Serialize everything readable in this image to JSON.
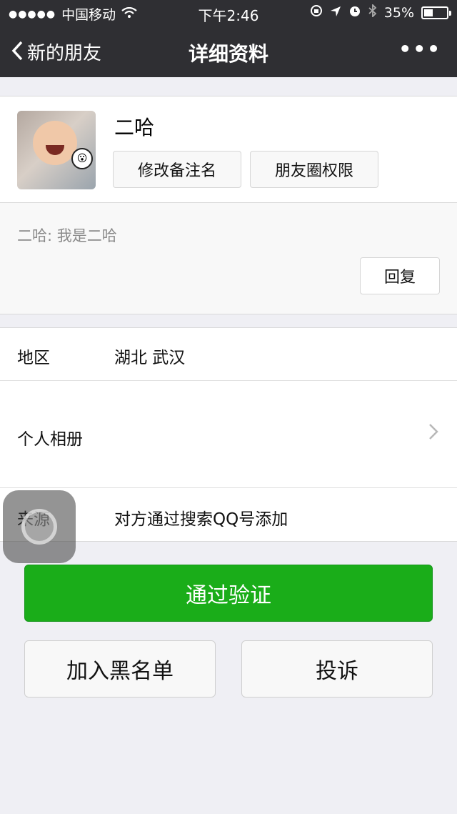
{
  "status_bar": {
    "signal_dots": "●●●●●",
    "carrier": "中国移动",
    "wifi_icon": "wifi-icon",
    "time": "下午2:46",
    "battery": "35%",
    "battery_level": 0.35
  },
  "nav": {
    "back_label": "新的朋友",
    "title": "详细资料",
    "more": "•••"
  },
  "profile": {
    "nickname": "二哈",
    "remark_button": "修改备注名",
    "moments_permission_button": "朋友圈权限"
  },
  "greeting": {
    "message": "二哈: 我是二哈",
    "reply_button": "回复"
  },
  "info": {
    "region_label": "地区",
    "region_value": "湖北 武汉",
    "album_label": "个人相册",
    "source_label": "来源",
    "source_value": "对方通过搜索QQ号添加"
  },
  "actions": {
    "approve": "通过验证",
    "blacklist": "加入黑名单",
    "report": "投诉"
  },
  "colors": {
    "nav_bg": "#2f2f33",
    "approve_green": "#1aad19",
    "page_bg": "#efeff4"
  }
}
